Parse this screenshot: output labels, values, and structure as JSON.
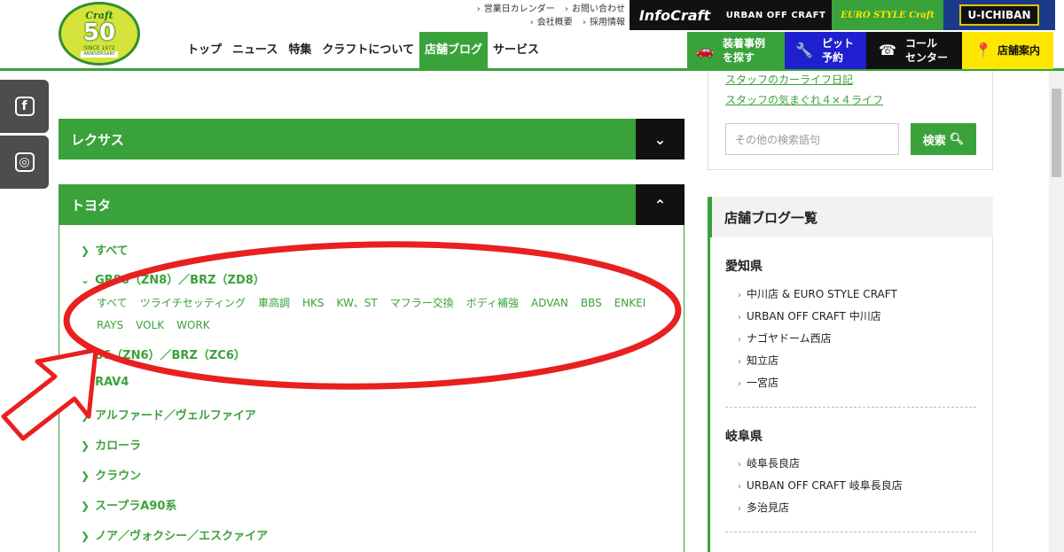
{
  "header": {
    "logo": {
      "brand": "Craft",
      "number": "50",
      "since": "SINCE 1972",
      "anniversary": "ANNIVERSARY"
    },
    "utility_links": [
      "営業日カレンダー",
      "お問い合わせ",
      "会社概要",
      "採用情報"
    ],
    "brand_tabs": [
      "InfoCraft",
      "URBAN OFF CRAFT",
      "EURO STYLE Craft",
      "U-ICHIBAN"
    ],
    "nav": [
      "トップ",
      "ニュース",
      "特集",
      "クラフトについて",
      "店舗ブログ",
      "サービス"
    ],
    "service_buttons": [
      {
        "line1": "装着事例",
        "line2": "を探す",
        "icon": "car-icon"
      },
      {
        "line1": "ピット",
        "line2": "予約",
        "icon": "wrench-icon"
      },
      {
        "line1": "コール",
        "line2": "センター",
        "icon": "phone-icon"
      },
      {
        "line1": "店舗案内",
        "icon": "pin-icon"
      }
    ]
  },
  "social": [
    "facebook-icon",
    "instagram-icon"
  ],
  "accordion": {
    "lexus": "レクサス",
    "toyota": "トヨタ",
    "toyota_items": [
      "すべて",
      "GR86（ZN8）／BRZ（ZD8）",
      "86（ZN6）／BRZ（ZC6）",
      "RAV4",
      "アルファード／ヴェルファイア",
      "カローラ",
      "クラウン",
      "スープラA90系",
      "ノア／ヴォクシー／エスクァイア"
    ],
    "gr86_tags": [
      "すべて",
      "ツライチセッティング",
      "車高調",
      "HKS",
      "KW、ST",
      "マフラー交換",
      "ボディ補強",
      "ADVAN",
      "BBS",
      "ENKEI",
      "RAYS",
      "VOLK",
      "WORK"
    ]
  },
  "sidebar": {
    "links": [
      "スタッフのカーライフ日記",
      "スタッフの気まぐれ４×４ライフ"
    ],
    "search_placeholder": "その他の検索語句",
    "search_button": "検索",
    "blog_list_title": "店舗ブログ一覧",
    "aichi": {
      "name": "愛知県",
      "shops": [
        "中川店 & EURO STYLE CRAFT",
        "URBAN OFF CRAFT 中川店",
        "ナゴヤドーム西店",
        "知立店",
        "一宮店"
      ]
    },
    "gifu": {
      "name": "岐阜県",
      "shops": [
        "岐阜長良店",
        "URBAN OFF CRAFT 岐阜長良店",
        "多治見店"
      ]
    }
  },
  "colors": {
    "green": "#3aa23a",
    "annotation_red": "#e8201f"
  }
}
